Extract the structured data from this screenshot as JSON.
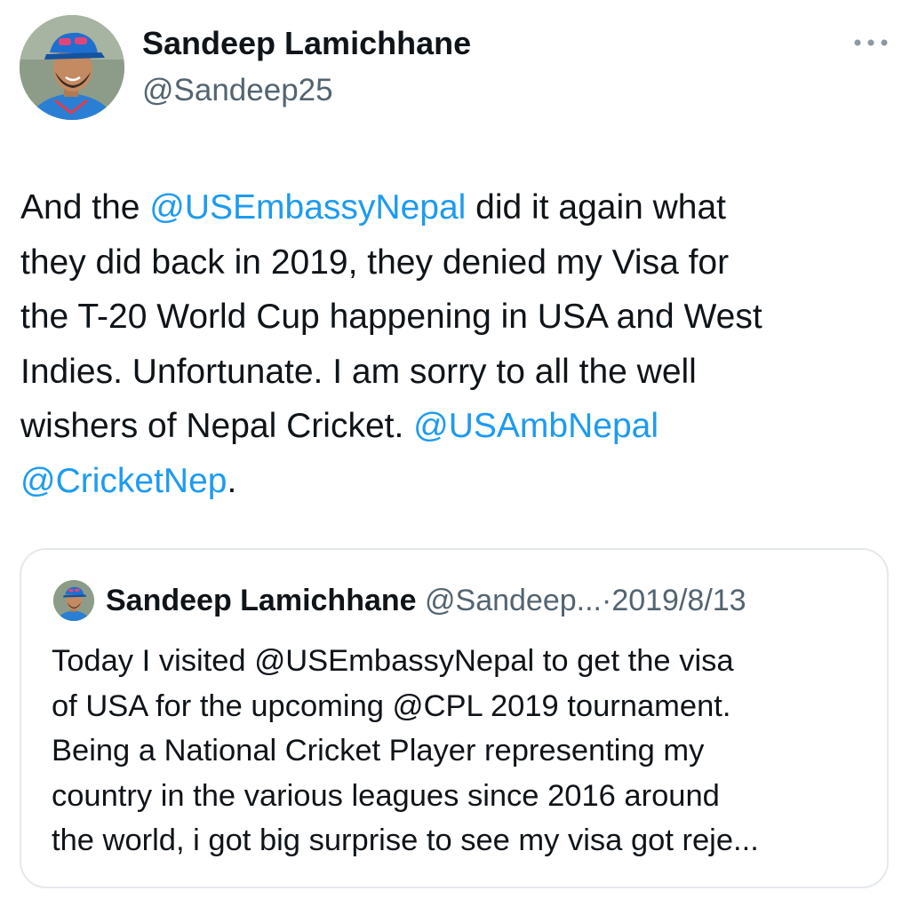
{
  "author": {
    "display_name": "Sandeep Lamichhane",
    "handle": "@Sandeep25"
  },
  "more_menu_icon": "more-horizontal-icon",
  "tweet_text": {
    "l1_a": "And the ",
    "l1_mention": "@USEmbassyNepal",
    "l1_b": " did it again what",
    "l2": "they did back in 2019, they denied my Visa for",
    "l3": "the T-20 World Cup happening in USA and West",
    "l4": "Indies. Unfortunate. I am sorry to all the well",
    "l5_a": "wishers of Nepal Cricket. ",
    "l5_mention": "@USAmbNepal",
    "l6_mention": "@CricketNep",
    "l6_b": "."
  },
  "quoted_tweet": {
    "display_name": "Sandeep Lamichhane",
    "handle_truncated": "@Sandeep...",
    "separator": "·",
    "date": "2019/8/13",
    "lines": [
      "Today I visited @USEmbassyNepal to get the visa",
      "of USA for the upcoming @CPL 2019 tournament.",
      "Being a National Cricket Player representing my",
      "country in the various leagues since 2016 around",
      "the world, i got big surprise to see my visa got reje..."
    ]
  },
  "colors": {
    "text_primary": "#0f1419",
    "text_secondary": "#536471",
    "link": "#1d9bf0",
    "card_border": "#e6e9ec"
  }
}
